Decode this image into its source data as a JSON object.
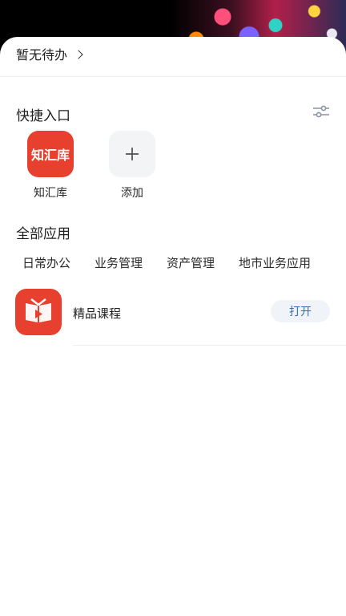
{
  "header": {
    "banner_image": "colorful-illustration"
  },
  "todo": {
    "label": "暂无待办",
    "icon": "chevron-right-icon"
  },
  "quick_access": {
    "title": "快捷入口",
    "settings_icon": "sliders-icon",
    "items": [
      {
        "name": "知汇库",
        "icon_text": "知汇库",
        "color": "#e8402f"
      },
      {
        "name": "添加",
        "icon": "plus-icon"
      }
    ]
  },
  "all_apps": {
    "title": "全部应用",
    "tabs": [
      "日常办公",
      "业务管理",
      "资产管理",
      "地市业务应用"
    ],
    "apps": [
      {
        "name": "精品课程",
        "action": "打开",
        "icon": "play-book-icon",
        "color": "#e8402f"
      }
    ]
  },
  "colors": {
    "accent_red": "#e8402f",
    "open_button_text": "#3d6ab0",
    "open_button_bg": "#f0f3f8"
  }
}
